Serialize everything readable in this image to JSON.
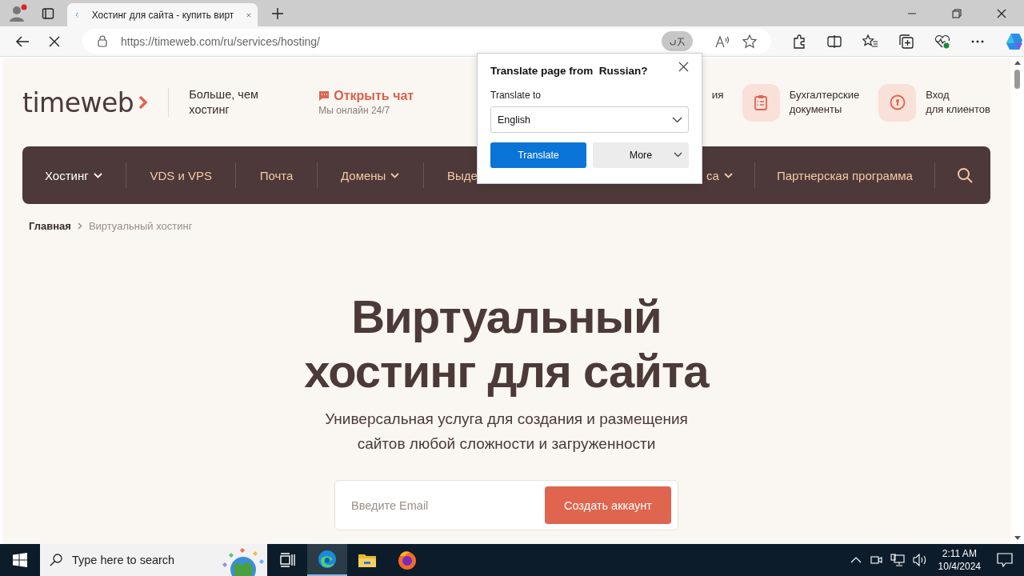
{
  "browser": {
    "tabs": [
      {
        "title": "Хостинг для сайта - купить вирт",
        "selected": true
      }
    ],
    "url_host": "https://timeweb.com",
    "url_path": "/ru/services/hosting/"
  },
  "translate_popup": {
    "title": "Translate page from  Russian?",
    "label": "Translate to",
    "language": "English",
    "buttons": [
      {
        "label": "Translate",
        "kind": "primary"
      },
      {
        "label": "More",
        "kind": "menu"
      }
    ]
  },
  "site": {
    "logo": "timeweb",
    "tagline": "Больше, чем\nхостинг",
    "chat": {
      "label": "Открыть чат",
      "sub": "Мы онлайн 24/7"
    },
    "header_links": [
      {
        "text": "ия",
        "kind": "partial"
      },
      {
        "text": "Бухгалтерские\nдокументы",
        "kind": "docs"
      },
      {
        "text": "Вход\nдля клиентов",
        "kind": "login"
      }
    ],
    "nav": [
      {
        "label": "Хостинг",
        "dropdown": true,
        "selected": true
      },
      {
        "label": "VDS и VPS",
        "dropdown": false,
        "selected": false
      },
      {
        "label": "Почта",
        "dropdown": false,
        "selected": false
      },
      {
        "label": "Домены",
        "dropdown": true,
        "selected": false
      },
      {
        "label": "Выде",
        "dropdown": false,
        "selected": false
      }
    ],
    "nav_right": [
      {
        "label": "са",
        "dropdown": true,
        "selected": false
      },
      {
        "label": "Партнерская программа",
        "dropdown": false,
        "selected": false
      }
    ],
    "breadcrumbs": [
      {
        "label": "Главная",
        "current": false
      },
      {
        "label": "Виртуальный хостинг",
        "current": true
      }
    ],
    "hero": {
      "title": "Виртуальный\nхостинг для сайта",
      "subtitle": "Универсальная услуга для создания и размещения\nсайтов любой сложности и загруженности",
      "email_placeholder": "Введите Email",
      "button": "Создать аккаунт"
    }
  },
  "taskbar": {
    "search_placeholder": "Type here to search",
    "time": "2:11 AM",
    "date": "10/4/2024",
    "apps": [
      {
        "kind": "taskview",
        "selected": false
      },
      {
        "kind": "edge",
        "selected": true
      },
      {
        "kind": "files",
        "selected": false
      },
      {
        "kind": "firefox",
        "selected": false
      }
    ]
  }
}
